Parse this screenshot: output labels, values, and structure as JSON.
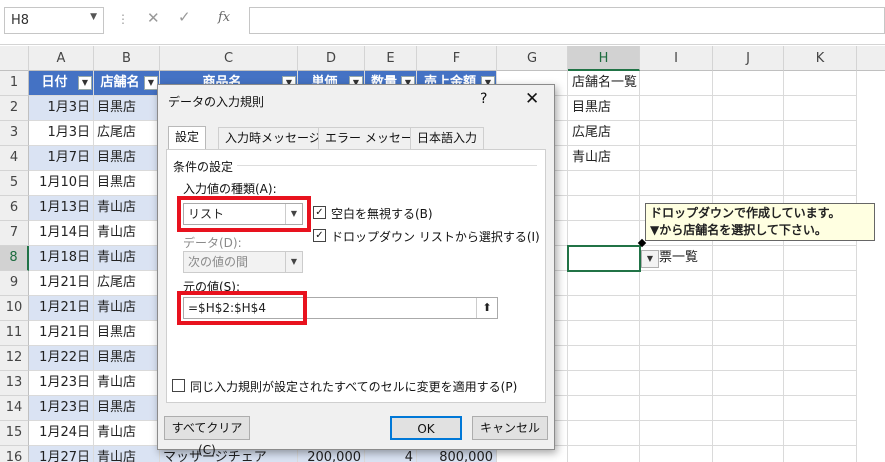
{
  "formula_bar": {
    "name_box": "H8",
    "cancel_icon": "✕",
    "enter_icon": "✓",
    "fx_label": "fx",
    "formula": ""
  },
  "columns": [
    "A",
    "B",
    "C",
    "D",
    "E",
    "F",
    "G",
    "H",
    "I",
    "J",
    "K"
  ],
  "rows": [
    "1",
    "2",
    "3",
    "4",
    "5",
    "6",
    "7",
    "8",
    "9",
    "10",
    "11",
    "12",
    "13",
    "14",
    "15",
    "16"
  ],
  "table_headers": [
    "日付",
    "店舗名",
    "商品名",
    "単価",
    "数量",
    "売上金額"
  ],
  "table": [
    {
      "date": "1月3日",
      "store": "目黒店"
    },
    {
      "date": "1月3日",
      "store": "広尾店"
    },
    {
      "date": "1月7日",
      "store": "目黒店"
    },
    {
      "date": "1月10日",
      "store": "目黒店"
    },
    {
      "date": "1月13日",
      "store": "青山店"
    },
    {
      "date": "1月14日",
      "store": "青山店"
    },
    {
      "date": "1月18日",
      "store": "青山店"
    },
    {
      "date": "1月21日",
      "store": "広尾店"
    },
    {
      "date": "1月21日",
      "store": "青山店"
    },
    {
      "date": "1月21日",
      "store": "目黒店"
    },
    {
      "date": "1月22日",
      "store": "目黒店"
    },
    {
      "date": "1月23日",
      "store": "青山店"
    },
    {
      "date": "1月23日",
      "store": "目黒店"
    },
    {
      "date": "1月24日",
      "store": "青山店"
    },
    {
      "date": "1月27日",
      "store": "青山店",
      "product": "マッサージチェア",
      "price": "200,000",
      "qty": "4",
      "sales": "800,000"
    }
  ],
  "store_list": {
    "title": "店舗名一覧",
    "items": [
      "目黒店",
      "広尾店",
      "青山店"
    ]
  },
  "cell_i8": "票一覧",
  "comment": {
    "line1": "ドロップダウンで作成しています。",
    "line2": "▼から店舗名を選択して下さい。"
  },
  "dialog": {
    "title": "データの入力規則",
    "help": "?",
    "close": "✕",
    "tabs": [
      "設定",
      "入力時メッセージ",
      "エラー メッセージ",
      "日本語入力"
    ],
    "section": "条件の設定",
    "allow_label": "入力値の種類(A):",
    "allow_value": "リスト",
    "ignore_blank": "空白を無視する(B)",
    "dropdown_opt": "ドロップダウン リストから選択する(I)",
    "data_label": "データ(D):",
    "data_value": "次の値の間",
    "source_label": "元の値(S):",
    "source_value": "=$H$2:$H$4",
    "apply_all": "同じ入力規則が設定されたすべてのセルに変更を適用する(P)",
    "clear_all": "すべてクリア(C)",
    "ok": "OK",
    "cancel": "キャンセル"
  },
  "colors": {
    "table_header": "#4472c4",
    "band": "#dae3f3",
    "highlight": "#e8121e",
    "selection": "#217346"
  }
}
